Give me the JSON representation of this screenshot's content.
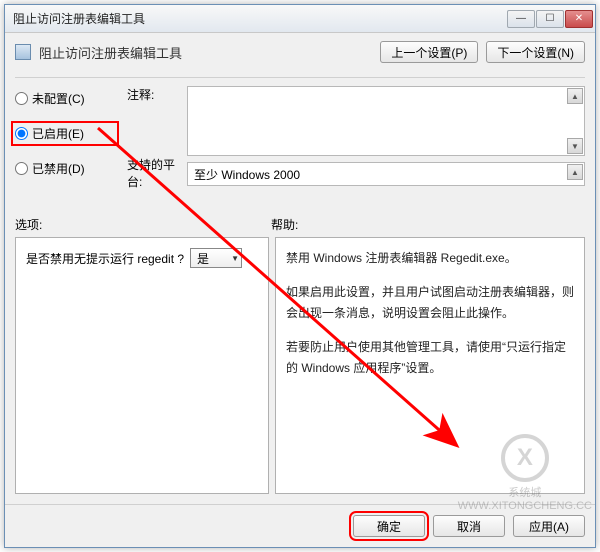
{
  "window": {
    "title": "阻止访问注册表编辑工具"
  },
  "header": {
    "title": "阻止访问注册表编辑工具",
    "prev_button": "上一个设置(P)",
    "next_button": "下一个设置(N)"
  },
  "radios": {
    "not_configured": "未配置(C)",
    "enabled": "已启用(E)",
    "disabled": "已禁用(D)",
    "selected": "enabled"
  },
  "labels": {
    "comment": "注释:",
    "platform": "支持的平台:",
    "options": "选项:",
    "help": "帮助:"
  },
  "platform_text": "至少 Windows 2000",
  "option": {
    "question": "是否禁用无提示运行 regedit ?",
    "selected": "是"
  },
  "help": {
    "p1": "禁用 Windows 注册表编辑器 Regedit.exe。",
    "p2": "如果启用此设置，并且用户试图启动注册表编辑器，则会出现一条消息，说明设置会阻止此操作。",
    "p3": "若要防止用户使用其他管理工具，请使用“只运行指定的 Windows 应用程序”设置。"
  },
  "footer": {
    "ok": "确定",
    "cancel": "取消",
    "apply": "应用(A)"
  },
  "watermark": {
    "text": "系统城",
    "url": "WWW.XITONGCHENG.CC"
  }
}
